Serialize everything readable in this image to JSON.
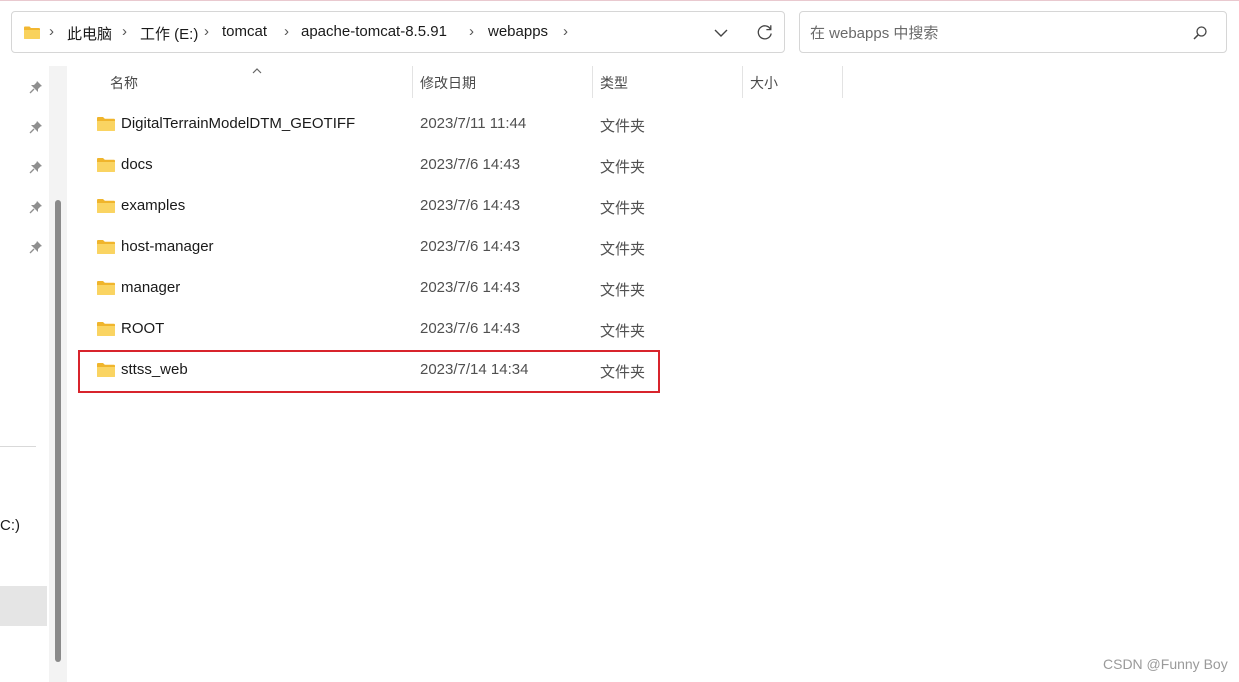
{
  "address_bar": {
    "breadcrumbs": [
      "此电脑",
      "工作 (E:)",
      "tomcat",
      "apache-tomcat-8.5.91",
      "webapps"
    ]
  },
  "search": {
    "placeholder": "在 webapps 中搜索"
  },
  "columns": {
    "name": "名称",
    "modified": "修改日期",
    "type": "类型",
    "size": "大小"
  },
  "files": [
    {
      "name": "DigitalTerrainModelDTM_GEOTIFF",
      "modified": "2023/7/11 11:44",
      "type": "文件夹"
    },
    {
      "name": "docs",
      "modified": "2023/7/6 14:43",
      "type": "文件夹"
    },
    {
      "name": "examples",
      "modified": "2023/7/6 14:43",
      "type": "文件夹"
    },
    {
      "name": "host-manager",
      "modified": "2023/7/6 14:43",
      "type": "文件夹"
    },
    {
      "name": "manager",
      "modified": "2023/7/6 14:43",
      "type": "文件夹"
    },
    {
      "name": "ROOT",
      "modified": "2023/7/6 14:43",
      "type": "文件夹"
    },
    {
      "name": "sttss_web",
      "modified": "2023/7/14 14:34",
      "type": "文件夹",
      "highlighted": true
    }
  ],
  "nav_pane": {
    "drive_fragment": "C:)"
  },
  "colors": {
    "folder": "#f7c948",
    "highlight_border": "#d8242c",
    "watermark": "#9a9a9a"
  },
  "icons": [
    "folder-icon",
    "chevron-right-icon",
    "chevron-down-icon",
    "refresh-icon",
    "search-icon",
    "pin-icon",
    "sort-up-icon"
  ],
  "watermark": "CSDN @Funny Boy"
}
